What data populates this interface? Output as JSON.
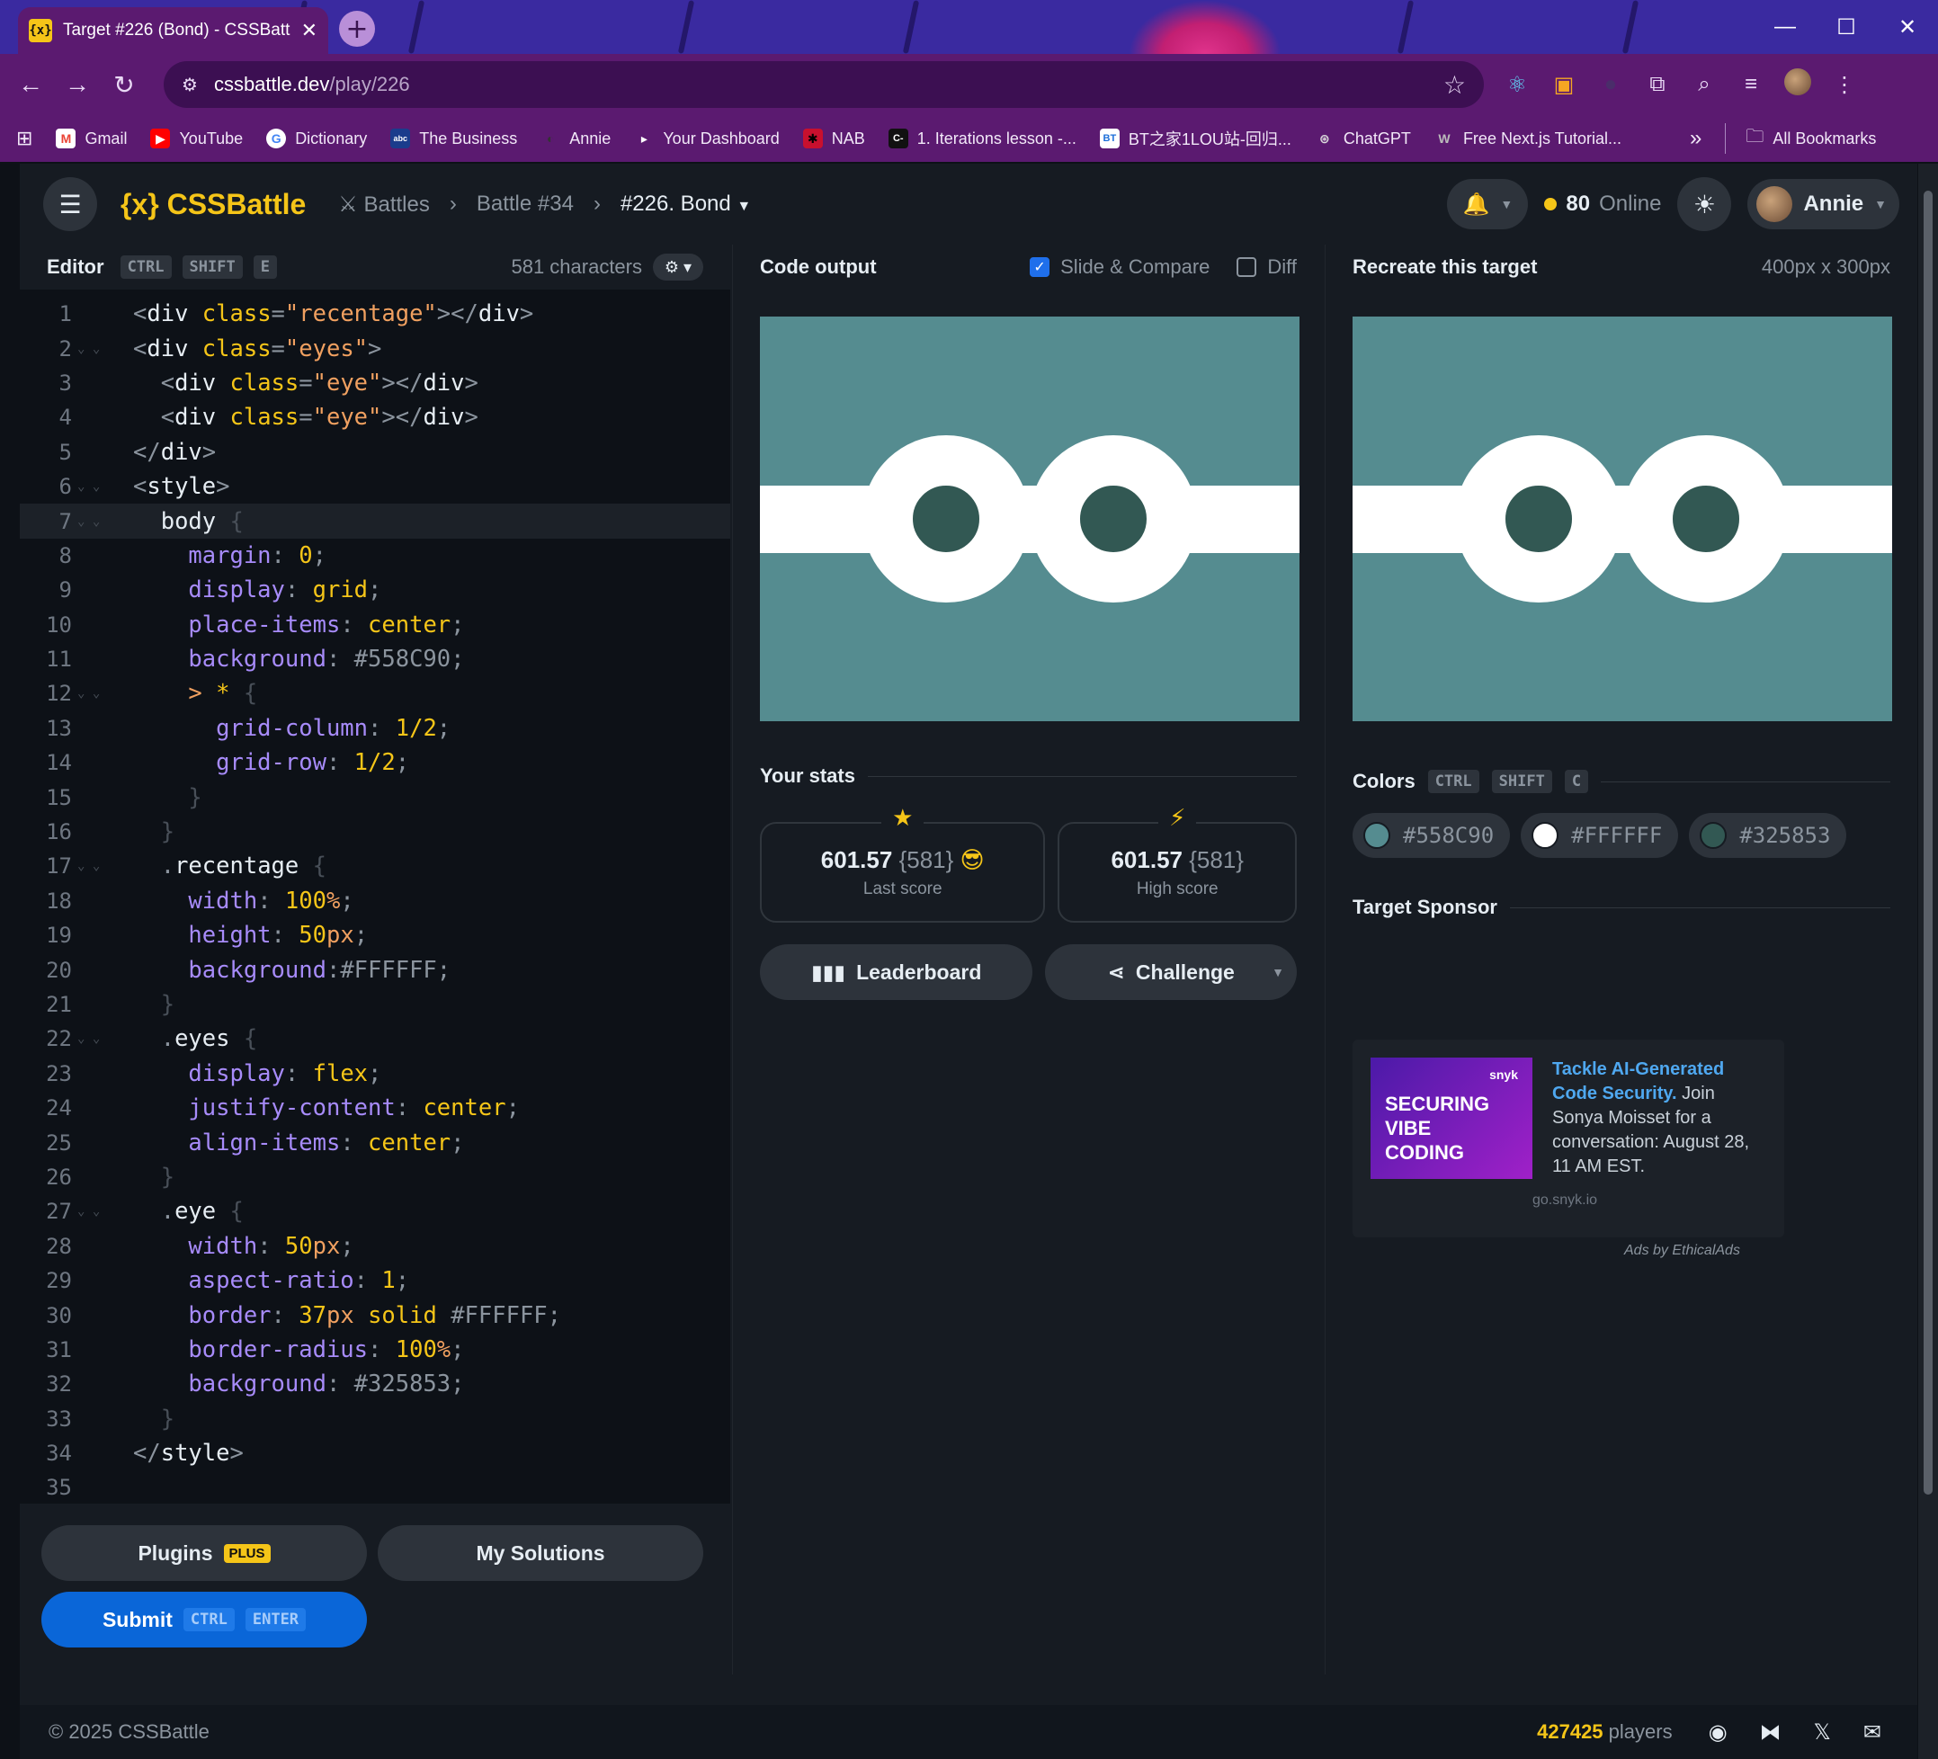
{
  "browser": {
    "tab_title": "Target #226 (Bond) - CSSBattle",
    "tab_close": "✕",
    "new_tab": "+",
    "url_host": "cssbattle.dev",
    "url_path": "/play/226",
    "window_controls": [
      "—",
      "☐",
      "✕"
    ],
    "bookmarks": [
      {
        "label": "Gmail",
        "icon": "M",
        "color": "#ea4335"
      },
      {
        "label": "YouTube",
        "icon": "▶",
        "color": "#ff0000"
      },
      {
        "label": "Dictionary",
        "icon": "G",
        "color": "#4285f4"
      },
      {
        "label": "The Business",
        "icon": "abc",
        "color": "#1a3c8c"
      },
      {
        "label": "Annie",
        "icon": "◐",
        "color": "#333333"
      },
      {
        "label": "Your Dashboard",
        "icon": "▸",
        "color": "#1b2b4a"
      },
      {
        "label": "NAB",
        "icon": "✱",
        "color": "#c8102e"
      },
      {
        "label": "1. Iterations lesson -...",
        "icon": "C-",
        "color": "#111111"
      },
      {
        "label": "BT之家1LOU站-回归...",
        "icon": "BT",
        "color": "#1e6fd9"
      },
      {
        "label": "ChatGPT",
        "icon": "⊛",
        "color": "#222222"
      },
      {
        "label": "Free Next.js Tutorial...",
        "icon": "W",
        "color": "#444444"
      }
    ],
    "bookmarks_more": "»",
    "all_bookmarks": "All Bookmarks"
  },
  "app": {
    "logo": "{x} CSSBattle",
    "crumbs": {
      "battles": "Battles",
      "battle": "Battle #34",
      "target": "#226. Bond"
    },
    "online_count": "80",
    "online_label": "Online",
    "user": "Annie"
  },
  "editor": {
    "title": "Editor",
    "shortcut": [
      "CTRL",
      "SHIFT",
      "E"
    ],
    "chars": "581 characters",
    "plugins_label": "Plugins",
    "plus_badge": "PLUS",
    "solutions_label": "My Solutions",
    "submit_label": "Submit",
    "submit_keys": [
      "CTRL",
      "ENTER"
    ]
  },
  "output": {
    "title": "Code output",
    "slide_compare": "Slide & Compare",
    "slide_compare_checked": true,
    "diff": "Diff",
    "diff_checked": false,
    "stats_title": "Your stats",
    "last_score": "601.57",
    "last_chars": "{581}",
    "last_label": "Last score",
    "high_score": "601.57",
    "high_chars": "{581}",
    "high_label": "High score",
    "leaderboard": "Leaderboard",
    "challenge": "Challenge"
  },
  "target": {
    "title": "Recreate this target",
    "size": "400px x 300px",
    "colors_title": "Colors",
    "colors_keys": [
      "CTRL",
      "SHIFT",
      "C"
    ],
    "colors": [
      "#558C90",
      "#FFFFFF",
      "#325853"
    ],
    "sponsor_title": "Target Sponsor",
    "ad_image_text": "SECURING VIBE CODING",
    "ad_brand": "snyk",
    "ad_headline": "Tackle AI-Generated Code Security.",
    "ad_body": "Join Sonya Moisset for a conversation: August 28, 11 AM EST.",
    "ad_domain": "go.snyk.io",
    "ads_by": "Ads by EthicalAds"
  },
  "footer": {
    "copyright": "© 2025 CSSBattle",
    "players_count": "427425",
    "players_label": "players"
  },
  "colors": {
    "target_bg": "#558C90",
    "target_white": "#FFFFFF",
    "target_eye": "#325853",
    "accent": "#F5C518"
  }
}
